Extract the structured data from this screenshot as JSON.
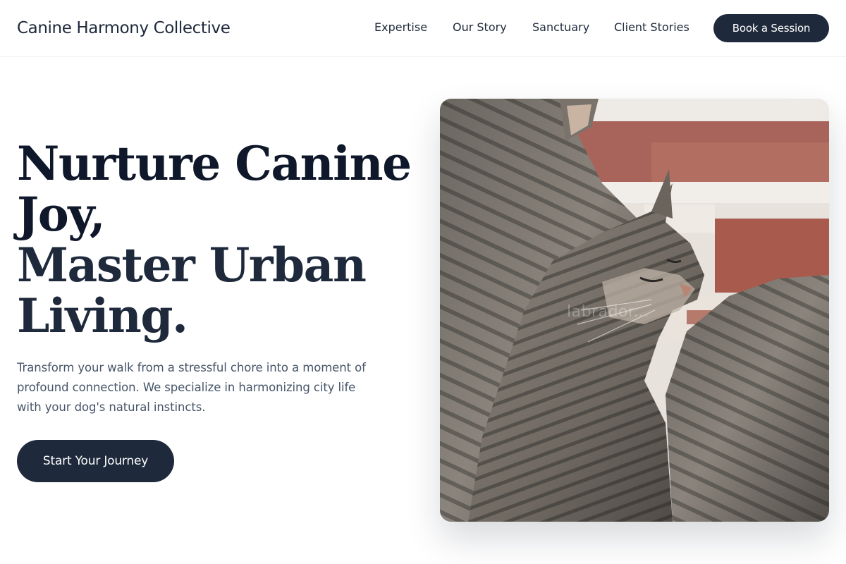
{
  "header": {
    "brand": "Canine Harmony Collective",
    "nav": [
      "Expertise",
      "Our Story",
      "Sanctuary",
      "Client Stories"
    ],
    "cta_label": "Book a Session"
  },
  "hero": {
    "title_line1": "Nurture Canine Joy,",
    "title_line2": "Master Urban Living.",
    "subtitle": "Transform your walk from a stressful chore into a moment of profound connection. We specialize in harmonizing city life with your dog's natural instincts.",
    "cta_label": "Start Your Journey",
    "image_watermark": "labrador..."
  },
  "colors": {
    "primary": "#1e293b",
    "heading": "#0f172a",
    "body_text": "#475569",
    "background": "#ffffff"
  }
}
